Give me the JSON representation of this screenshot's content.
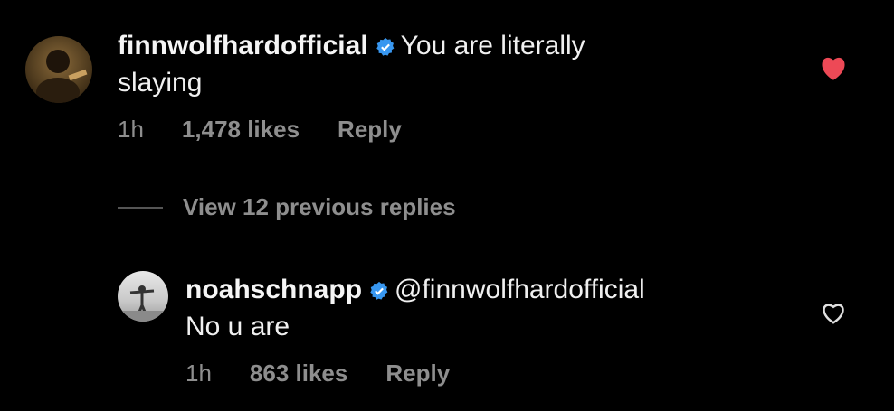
{
  "comment": {
    "username": "finnwolfhardofficial",
    "text_line1": "You are literally",
    "text_line2": "slaying",
    "time": "1h",
    "likes": "1,478 likes",
    "reply_label": "Reply",
    "liked": true
  },
  "view_replies": {
    "label": "View 12 previous replies"
  },
  "reply": {
    "username": "noahschnapp",
    "mention": "@finnwolfhardofficial",
    "text": "No u are",
    "time": "1h",
    "likes": "863 likes",
    "reply_label": "Reply",
    "liked": false
  },
  "colors": {
    "background": "#000000",
    "verified": "#3897f0",
    "heart_liked": "#ed4956",
    "muted": "#8e8e8e"
  }
}
